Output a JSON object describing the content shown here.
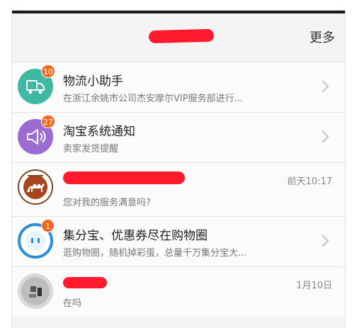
{
  "header": {
    "more_label": "更多"
  },
  "conversations": [
    {
      "title": "物流小助手",
      "subtitle": "在浙江余姚市公司杰安摩尔VIP服务部进行...",
      "badge": "10",
      "avatar_color": "#3eb7a3",
      "icon": "truck-icon"
    },
    {
      "title": "淘宝系统通知",
      "subtitle": "卖家发货提醒",
      "badge": "27",
      "avatar_color": "#9b6bd1",
      "icon": "speaker-icon"
    },
    {
      "title": "",
      "subtitle": "您对我的服务满意吗?",
      "time": "前天10:17",
      "icon": "camel-logo-icon"
    },
    {
      "title": "集分宝、优惠券尽在购物圈",
      "subtitle": "逛购物圈，随机掉彩蛋，总量千万集分宝大...",
      "badge": "1",
      "avatar_color": "#2b8fe0",
      "icon": "circle-face-icon"
    },
    {
      "title": "",
      "subtitle": "在吗",
      "time": "1月10日",
      "icon": "user-photo-icon"
    }
  ],
  "colors": {
    "accent": "#f5681f",
    "redaction": "#ff1a2e"
  }
}
